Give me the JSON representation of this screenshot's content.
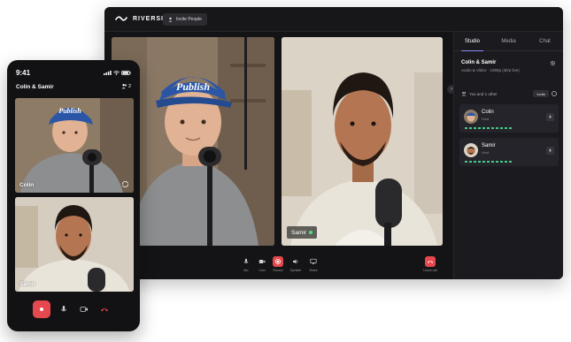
{
  "desktop": {
    "brand": "RIVERSIDE",
    "invite_button": "Invite People",
    "participants": {
      "colin": {
        "name": "Colin",
        "cap_text": "Publish"
      },
      "samir": {
        "name": "Samir"
      }
    },
    "controls": [
      {
        "id": "mic",
        "label": "Mic",
        "icon": "mic-icon"
      },
      {
        "id": "cam",
        "label": "Cam",
        "icon": "camera-icon"
      },
      {
        "id": "record",
        "label": "Record",
        "icon": "record-icon"
      },
      {
        "id": "speaker",
        "label": "Speaker",
        "icon": "speaker-icon"
      },
      {
        "id": "share",
        "label": "Share",
        "icon": "screen-share-icon"
      },
      {
        "id": "leave",
        "label": "Leave call",
        "icon": "hang-up-icon"
      }
    ],
    "panel": {
      "tabs": [
        "Studio",
        "Media",
        "Chat"
      ],
      "active_tab": "Studio",
      "session_title": "Colin & Samir",
      "session_subtitle": "Audio & Video · 1080p (4k/p live)",
      "you_row": "You and 1 other",
      "invite_small": "Invite",
      "people": [
        {
          "name": "Colin",
          "role": "Host"
        },
        {
          "name": "Samir",
          "role": "Host"
        }
      ]
    },
    "colors": {
      "record_red": "#e5484d",
      "accent": "#8b8bf5",
      "meter_green": "#47c98a"
    }
  },
  "phone": {
    "time": "9:41",
    "title": "Colin & Samir",
    "people_count": "2",
    "tiles": [
      {
        "name": "Colin",
        "cap_text": "Publish"
      },
      {
        "name": "Samir"
      }
    ]
  }
}
